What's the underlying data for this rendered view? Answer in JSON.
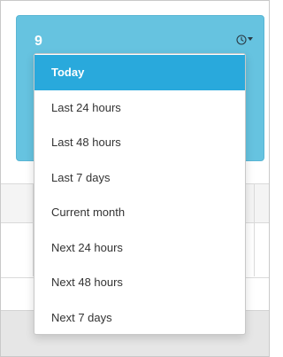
{
  "widget": {
    "count": "9",
    "accent_color": "#66c3e0",
    "icon": "clock-icon"
  },
  "dropdown": {
    "selected_index": 0,
    "items": [
      {
        "label": "Today"
      },
      {
        "label": "Last 24 hours"
      },
      {
        "label": "Last 48 hours"
      },
      {
        "label": "Last 7 days"
      },
      {
        "label": "Current month"
      },
      {
        "label": "Next 24 hours"
      },
      {
        "label": "Next 48 hours"
      },
      {
        "label": "Next 7 days"
      }
    ],
    "active_color": "#29a9dc"
  }
}
